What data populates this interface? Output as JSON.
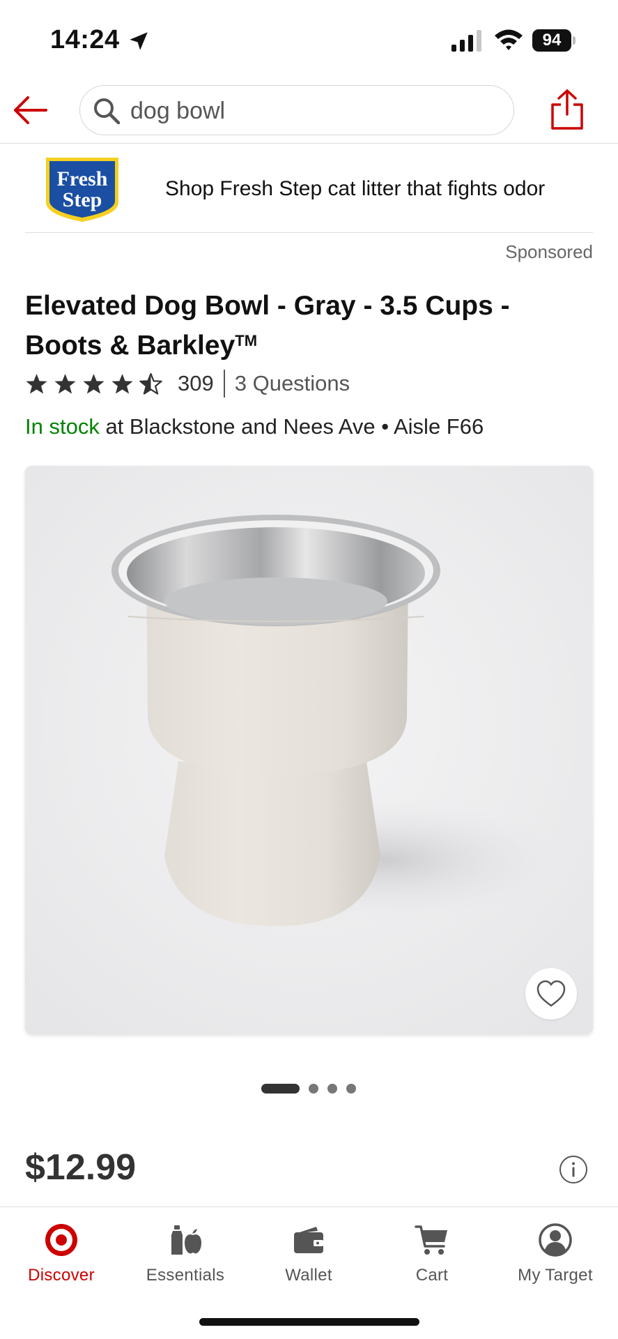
{
  "status_bar": {
    "time": "14:24",
    "battery": "94"
  },
  "header": {
    "search_value": "dog bowl"
  },
  "ad": {
    "brand_line1": "Fresh",
    "brand_line2": "Step",
    "text": "Shop Fresh Step cat litter that fights odor",
    "sponsored_label": "Sponsored"
  },
  "product": {
    "title": "Elevated Dog Bowl - Gray - 3.5 Cups - Boots & Barkley",
    "trademark": "TM",
    "rating": 4.5,
    "review_count": "309",
    "questions": "3 Questions",
    "stock_status": "In stock",
    "stock_location": " at Blackstone and Nees Ave • Aisle F66",
    "price": "$12.99"
  },
  "carousel": {
    "total": 4,
    "active_index": 0
  },
  "colors": {
    "brand_red": "#cc0000",
    "in_stock_green": "#008300"
  },
  "bottom_nav": [
    {
      "label": "Discover",
      "icon": "target-bullseye-icon",
      "active": true
    },
    {
      "label": "Essentials",
      "icon": "essentials-icon",
      "active": false
    },
    {
      "label": "Wallet",
      "icon": "wallet-icon",
      "active": false
    },
    {
      "label": "Cart",
      "icon": "cart-icon",
      "active": false
    },
    {
      "label": "My Target",
      "icon": "account-icon",
      "active": false
    }
  ]
}
